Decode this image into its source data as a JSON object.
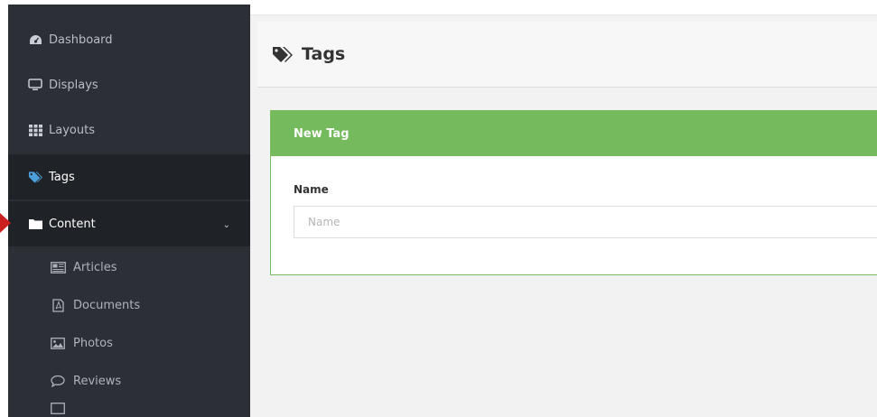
{
  "sidebar": {
    "items": [
      {
        "label": "Dashboard",
        "icon": "dashboard-icon"
      },
      {
        "label": "Displays",
        "icon": "monitor-icon"
      },
      {
        "label": "Layouts",
        "icon": "grid-icon"
      },
      {
        "label": "Tags",
        "icon": "tags-icon"
      },
      {
        "label": "Content",
        "icon": "folder-icon"
      }
    ],
    "content_chevron": "⌄",
    "subitems": [
      {
        "label": "Articles",
        "icon": "newspaper-icon"
      },
      {
        "label": "Documents",
        "icon": "pdf-document-icon"
      },
      {
        "label": "Photos",
        "icon": "image-icon"
      },
      {
        "label": "Reviews",
        "icon": "comment-icon"
      }
    ]
  },
  "header": {
    "title": "Tags",
    "icon": "tags-icon"
  },
  "panel": {
    "title": "New Tag",
    "field_label": "Name",
    "field_placeholder": "Name",
    "field_value": ""
  },
  "colors": {
    "sidebar_bg": "#2c3036",
    "sidebar_active_bg": "#1f2226",
    "accent_green": "#75bb5e",
    "tag_icon_blue": "#4a9fdc",
    "pointer_red": "#cc1f1f"
  }
}
